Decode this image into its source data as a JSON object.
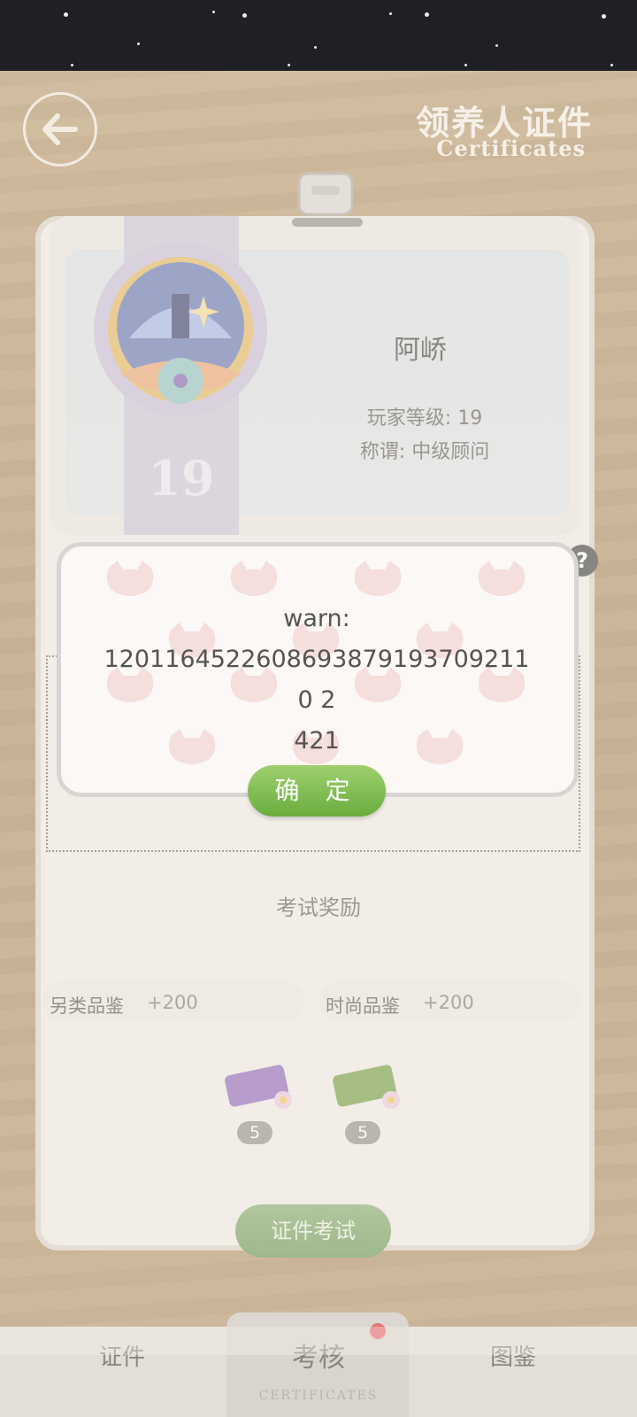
{
  "header": {
    "title_cn": "领养人证件",
    "title_en": "Certificates"
  },
  "badge": {
    "rank_number": "19"
  },
  "player": {
    "name": "阿峤",
    "level": "玩家等级: 19",
    "title": "称谓: 中级顾问"
  },
  "help": {
    "label": "?"
  },
  "rewards": {
    "title": "考试奖励",
    "items": [
      {
        "label": "另类品鉴",
        "amount": "+200"
      },
      {
        "label": "时尚品鉴",
        "amount": "+200"
      }
    ],
    "gifts": [
      {
        "count": "5",
        "color": "#8a5fb8"
      },
      {
        "count": "5",
        "color": "#6e9a3c"
      }
    ]
  },
  "exam_button": {
    "label": "证件考试"
  },
  "dialog": {
    "message": "warn:\n12011645226086938791937092110 2421",
    "message_line1": "warn:",
    "message_line2": "12011645226086938791937092110 2",
    "message_line3": "421",
    "confirm_label": "确 定"
  },
  "nav": {
    "tabs": [
      {
        "label": "证件"
      },
      {
        "label": "考核",
        "sub_label": "CERTIFICATES",
        "active": true
      },
      {
        "label": "图鉴"
      }
    ]
  },
  "colors": {
    "confirm_green": "#79b94a",
    "notification_red": "#d81e28"
  }
}
